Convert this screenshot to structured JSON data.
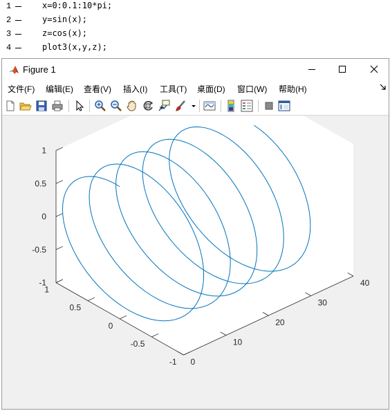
{
  "editor": {
    "lines": [
      {
        "number": "1",
        "code": "x=0:0.1:10*pi;"
      },
      {
        "number": "2",
        "code": "y=sin(x);"
      },
      {
        "number": "3",
        "code": "z=cos(x);"
      },
      {
        "number": "4",
        "code": "plot3(x,y,z);"
      }
    ]
  },
  "window": {
    "title": "Figure 1",
    "menu": [
      "文件(F)",
      "编辑(E)",
      "查看(V)",
      "插入(I)",
      "工具(T)",
      "桌面(D)",
      "窗口(W)",
      "帮助(H)"
    ]
  },
  "toolbar": {
    "icons": [
      "new-figure-icon",
      "open-file-icon",
      "save-icon",
      "print-icon",
      "select-arrow-icon",
      "zoom-in-icon",
      "zoom-out-icon",
      "pan-hand-icon",
      "rotate-3d-icon",
      "data-cursor-icon",
      "brush-icon",
      "link-plot-icon",
      "colorbar-icon",
      "legend-icon",
      "hide-tools-icon",
      "show-tools-icon"
    ]
  },
  "colors": {
    "line": "#0072bd",
    "axes_background": "#ffffff",
    "figure_background": "#f0f0f0"
  },
  "chart_data": {
    "type": "line",
    "projection": "3d",
    "x": {
      "start": 0,
      "step": 0.1,
      "end": 31.4159
    },
    "y_expression": "sin(x)",
    "z_expression": "cos(x)",
    "xlim": [
      0,
      40
    ],
    "ylim": [
      -1,
      1
    ],
    "zlim": [
      -1,
      1
    ],
    "xticks": [
      "0",
      "10",
      "20",
      "30",
      "40"
    ],
    "yticks": [
      "-1",
      "-0.5",
      "0",
      "0.5",
      "1"
    ],
    "zticks": [
      "-1",
      "-0.5",
      "0",
      "0.5",
      "1"
    ],
    "grid": false,
    "title": "",
    "xlabel": "",
    "ylabel": "",
    "zlabel": ""
  }
}
